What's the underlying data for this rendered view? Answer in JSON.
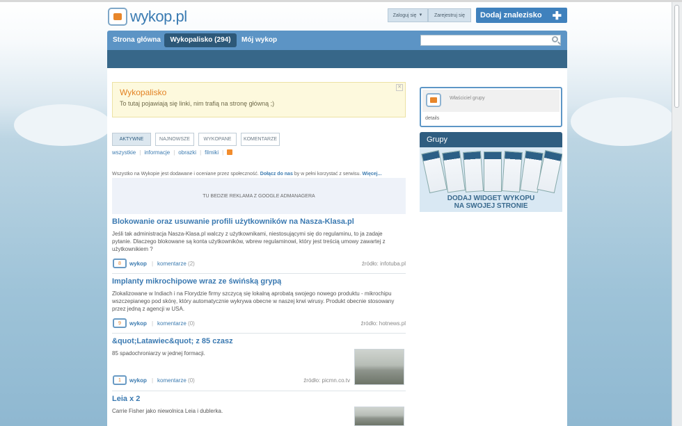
{
  "header": {
    "logo_text": "wykop.pl",
    "login_label": "Zaloguj się",
    "register_label": "Zarejestruj się",
    "add_label": "Dodaj znalezisko",
    "add_icon": "plus-icon"
  },
  "nav": {
    "items": [
      "Strona główna",
      "Wykopalisko (294)",
      "Mój wykop"
    ],
    "active": "Wykopalisko (294)",
    "search_placeholder": ""
  },
  "notice": {
    "title": "Wykopalisko",
    "text": "To tutaj pojawiają się linki, nim trafią na stronę główną ;)"
  },
  "tabs": [
    "AKTYWNE",
    "NAJNOWSZE",
    "WYKOPANE",
    "KOMENTARZE"
  ],
  "filters": [
    "wszystkie",
    "informacje",
    "obrazki",
    "filmiki"
  ],
  "info": {
    "text": "Wszystko na Wykopie jest dodawane i oceniane przez społeczność.",
    "join_link": "Dołącz do nas",
    "text2": "by w pełni korzystać z serwisu.",
    "more_link": "Więcej..."
  },
  "ad_text": "TU BEDZIE REKLAMA Z GOOGLE ADMANAGERA",
  "articles": [
    {
      "title": "Blokowanie oraz usuwanie profili użytkowników na Nasza-Klasa.pl",
      "desc": "Jeśli tak administracja Nasza-Klasa.pl walczy z użytkownikami, niestosującymi się do regulaminu, to ja zadaje pytanie. Dlaczego blokowane są konta użytkowników, wbrew regulaminowi, który jest treścią umowy zawartej z użytkownikiem ?",
      "count": "8",
      "wykop": "wykop",
      "comments": "komentarze",
      "comments_count": "(2)",
      "source": "źródło: infotuba.pl"
    },
    {
      "title": "Implanty mikrochipowe wraz ze świńską grypą",
      "desc": "Zlokalizowane w Indiach i na Florydzie firmy szczycą się lokalną aprobatą swojego nowego produktu - mikrochipu wszczepianego pod skórę, który automatycznie wykrywa obecne w naszej krwi wirusy. Produkt obecnie stosowany przez jedną z agencji w USA.",
      "count": "9",
      "wykop": "wykop",
      "comments": "komentarze",
      "comments_count": "(0)",
      "source": "źródło: hotnews.pl"
    },
    {
      "title": "&quot;Latawiec&quot; z 85 czasz",
      "desc": "85 spadochroniarzy w jednej formacji.",
      "count": "1",
      "wykop": "wykop",
      "comments": "komentarze",
      "comments_count": "(0)",
      "source": "źródło: picmn.co.tv"
    },
    {
      "title": "Leia x 2",
      "desc": "Carrie Fisher jako niewolnica Leia i dublerka."
    }
  ],
  "sidebar": {
    "owner_label": "Właściciel grupy",
    "details_label": "details",
    "groups_title": "Grupy",
    "widget_line1": "DODAJ WIDGET WYKOPU",
    "widget_line2": "NA SWOJEJ STRONIE"
  },
  "colors": {
    "brand_blue": "#5c94c5",
    "dark_blue": "#2f5d80",
    "accent_orange": "#e38224"
  }
}
